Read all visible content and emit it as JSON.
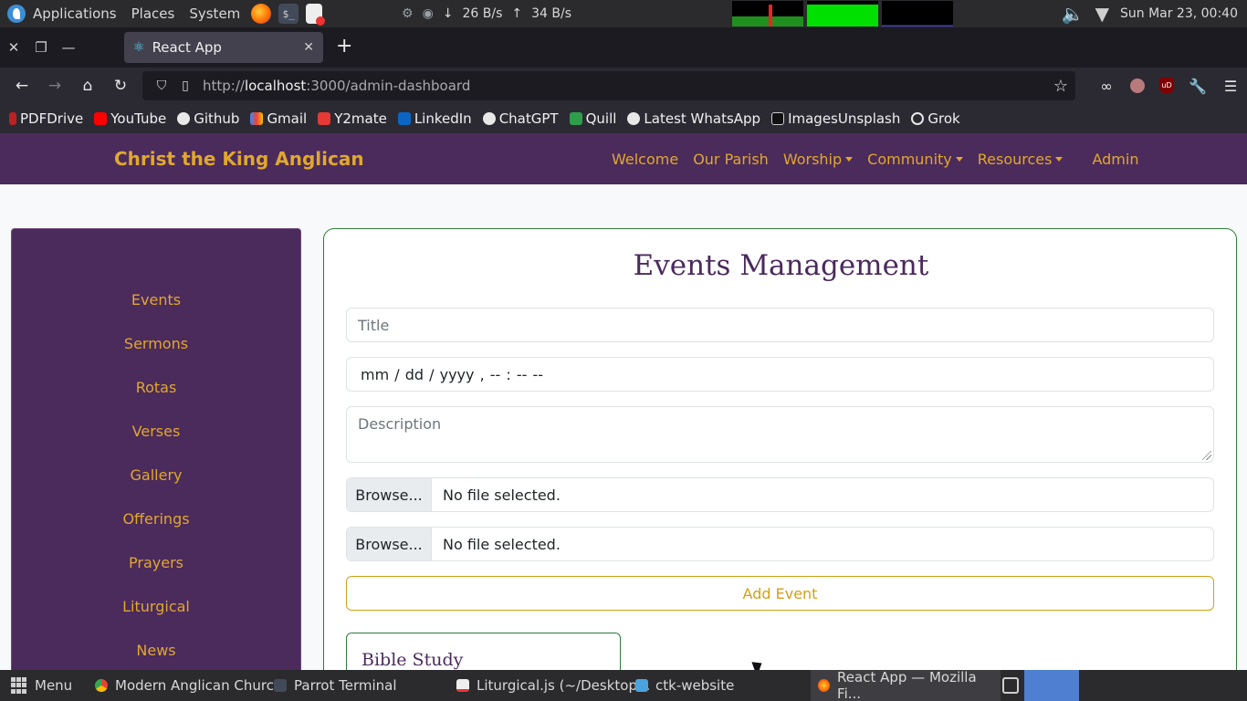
{
  "os_panel": {
    "menus": [
      "Applications",
      "Places",
      "System"
    ],
    "net_down": "26 B/s",
    "net_up": "34 B/s",
    "clock": "Sun Mar 23, 00:40"
  },
  "browser": {
    "tab_title": "React App",
    "url_prefix": "http://",
    "url_host": "localhost",
    "url_path": ":3000/admin-dashboard",
    "bookmarks": [
      "PDFDrive",
      "YouTube",
      "Github",
      "Gmail",
      "Y2mate",
      "LinkedIn",
      "ChatGPT",
      "Quill",
      "Latest WhatsApp",
      "ImagesUnsplash",
      "Grok"
    ]
  },
  "site": {
    "brand": "Christ the King Anglican",
    "nav": {
      "welcome": "Welcome",
      "parish": "Our Parish",
      "worship": "Worship",
      "community": "Community",
      "resources": "Resources",
      "admin": "Admin"
    }
  },
  "sidebar": {
    "items": [
      "Events",
      "Sermons",
      "Rotas",
      "Verses",
      "Gallery",
      "Offerings",
      "Prayers",
      "Liturgical",
      "News"
    ]
  },
  "events_form": {
    "heading": "Events Management",
    "title_placeholder": "Title",
    "date_value": "mm / dd / yyyy ,  -- : --   --",
    "description_placeholder": "Description",
    "browse_label": "Browse...",
    "file_status": "No file selected.",
    "add_button": "Add Event"
  },
  "events_list": [
    {
      "title": "Bible Study"
    }
  ],
  "taskbar": {
    "menu": "Menu",
    "tasks": [
      "Modern Anglican Churc...",
      "Parrot Terminal",
      "Liturgical.js (~/Desktop...",
      "ctk-website",
      "React App — Mozilla Fi..."
    ]
  },
  "colors": {
    "purple": "#4b2a5c",
    "gold": "#e0a82e",
    "card_border": "#2f7d3a"
  }
}
